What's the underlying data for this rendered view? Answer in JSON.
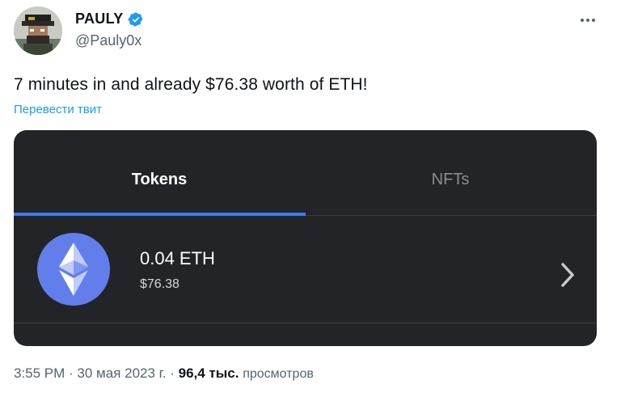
{
  "tweet": {
    "author_name": "PAULY",
    "handle": "@Pauly0x",
    "text": "7 minutes in and already $76.38 worth of ETH!",
    "translate_label": "Перевести твит",
    "verified_badge_color": "#1d9bf0"
  },
  "card": {
    "tabs": [
      {
        "label": "Tokens",
        "active": true
      },
      {
        "label": "NFTs",
        "active": false
      }
    ],
    "token": {
      "icon": "ethereum-icon",
      "amount": "0.04 ETH",
      "usd_value": "$76.38"
    },
    "accent_color": "#3d7df0",
    "background_color": "#232427"
  },
  "meta": {
    "time_date": "3:55 PM · 30 мая 2023 г. · ",
    "views_count": "96,4 тыс.",
    "views_label": "просмотров"
  }
}
